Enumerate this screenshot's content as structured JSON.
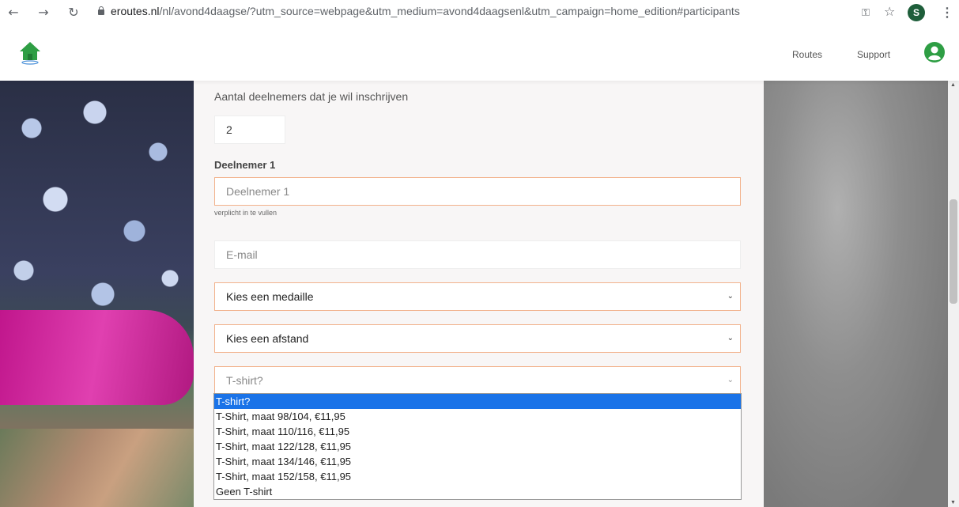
{
  "browser": {
    "url_host": "eroutes.nl",
    "url_path": "/nl/avond4daagse/?utm_source=webpage&utm_medium=avond4daagsenl&utm_campaign=home_edition#participants",
    "profile_initial": "S"
  },
  "header": {
    "nav": [
      {
        "label": "Routes"
      },
      {
        "label": "Support"
      }
    ],
    "colors": {
      "brand_green": "#2e9e44"
    }
  },
  "form": {
    "count_label": "Aantal deelnemers dat je wil inschrijven",
    "count_value": "2",
    "participant_heading": "Deelnemer 1",
    "name_placeholder": "Deelnemer 1",
    "name_hint": "verplicht in te vullen",
    "email_placeholder": "E-mail",
    "medal_select": "Kies een medaille",
    "distance_select": "Kies een afstand",
    "tshirt_select": "T-shirt?",
    "tshirt_options": [
      "T-shirt?",
      "T-Shirt, maat 98/104, €11,95",
      "T-Shirt, maat 110/116, €11,95",
      "T-Shirt, maat 122/128, €11,95",
      "T-Shirt, maat 134/146, €11,95",
      "T-Shirt, maat 152/158, €11,95",
      "Geen T-shirt"
    ],
    "selected_option_index": 0,
    "accent_color": "#f2b28c"
  }
}
